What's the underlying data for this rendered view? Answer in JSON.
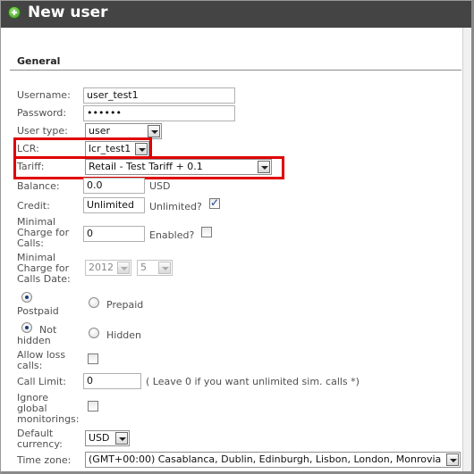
{
  "window": {
    "title": "New user",
    "icon": "plus-circle-icon"
  },
  "section": {
    "title": "General"
  },
  "fields": {
    "username": {
      "label": "Username:",
      "value": "user_test1"
    },
    "password": {
      "label": "Password:",
      "value": "••••••"
    },
    "user_type": {
      "label": "User type:",
      "value": "user"
    },
    "lcr": {
      "label": "LCR:",
      "value": "lcr_test1"
    },
    "tariff": {
      "label": "Tariff:",
      "value": "Retail - Test Tariff + 0.1"
    },
    "balance": {
      "label": "Balance:",
      "value": "0.0",
      "unit": "USD"
    },
    "credit": {
      "label": "Credit:",
      "value": "Unlimited",
      "unlimited_label": "Unlimited?",
      "unlimited_checked": true
    },
    "min_charge": {
      "label_1": "Minimal",
      "label_2": "Charge for",
      "label_3": "Calls:",
      "value": "0",
      "enabled_label": "Enabled?",
      "enabled_checked": false
    },
    "min_charge_date": {
      "label_1": "Minimal",
      "label_2": "Charge for",
      "label_3": "Calls Date:",
      "year": "2012",
      "month": "5"
    },
    "payment": {
      "postpaid_label": "Postpaid",
      "prepaid_label": "Prepaid",
      "selected": "Postpaid"
    },
    "visibility": {
      "not_hidden_label_1": "Not",
      "not_hidden_label_2": "hidden",
      "hidden_label": "Hidden",
      "selected": "Not hidden"
    },
    "allow_loss": {
      "label_1": "Allow loss",
      "label_2": "calls:",
      "checked": false
    },
    "call_limit": {
      "label": "Call Limit:",
      "value": "0",
      "hint": "( Leave 0 if you want unlimited sim. calls *)"
    },
    "ignore_monitorings": {
      "label_1": "Ignore",
      "label_2": "global",
      "label_3": "monitorings:",
      "checked": false
    },
    "currency": {
      "label_1": "Default",
      "label_2": "currency:",
      "value": "USD"
    },
    "time_zone": {
      "label": "Time zone:",
      "value": "(GMT+00:00) Casablanca, Dublin, Edinburgh, Lisbon, London, Monrovia"
    }
  },
  "colors": {
    "titlebar": "#444444",
    "highlight": "#e00000",
    "section_rule": "#8a8a8a"
  }
}
